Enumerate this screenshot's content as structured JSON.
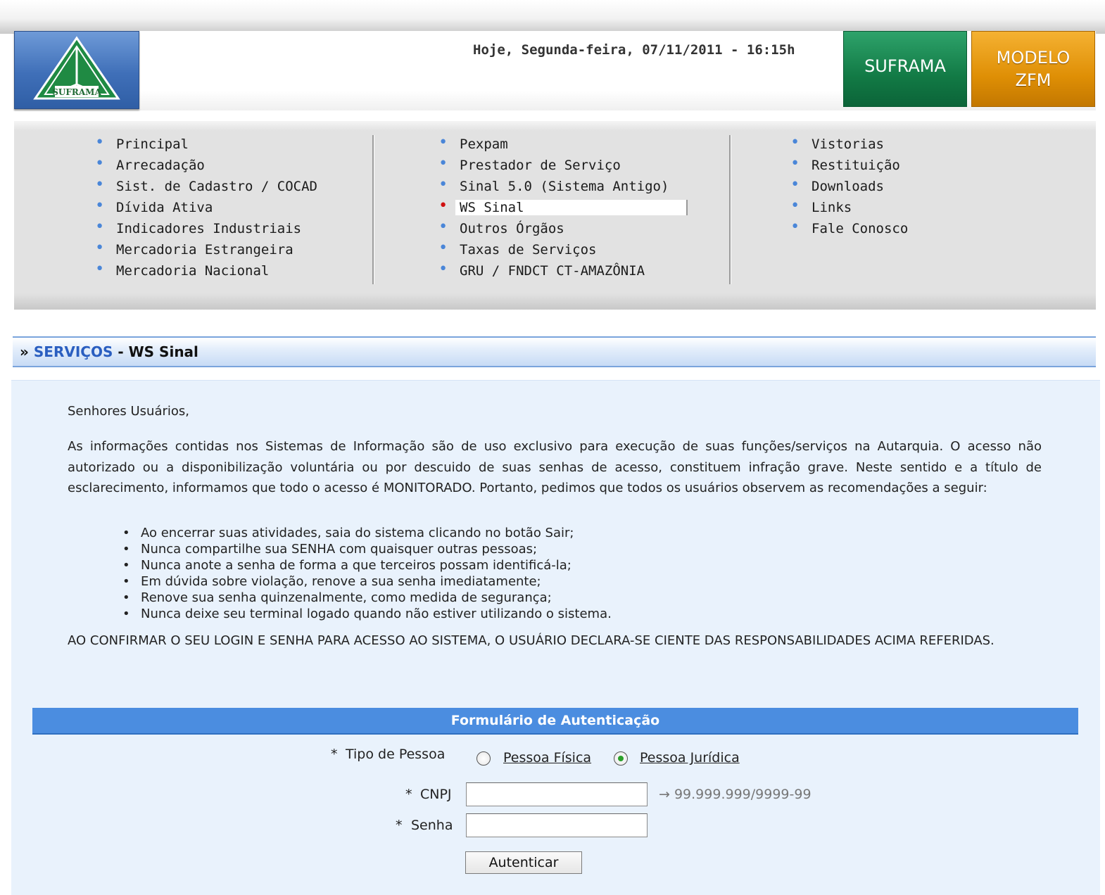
{
  "header": {
    "date_text": "Hoje, Segunda-feira, 07/11/2011 - 16:15h",
    "logo_text": "SUFRAMA",
    "button_suframa": "SUFRAMA",
    "button_modelo_line1": "MODELO",
    "button_modelo_line2": "ZFM"
  },
  "menu": {
    "col1": [
      "Principal",
      "Arrecadação",
      "Sist. de Cadastro / COCAD",
      "Dívida Ativa",
      "Indicadores Industriais",
      "Mercadoria Estrangeira",
      "Mercadoria Nacional"
    ],
    "col2": [
      "Pexpam",
      "Prestador de Serviço",
      "Sinal 5.0 (Sistema Antigo)",
      "WS Sinal",
      "Outros Órgãos",
      "Taxas de Serviços",
      "GRU / FNDCT CT-AMAZÔNIA"
    ],
    "col3": [
      "Vistorias",
      "Restituição",
      "Downloads",
      "Links",
      "Fale Conosco"
    ],
    "active_item": "WS Sinal"
  },
  "breadcrumb": {
    "prefix": "»",
    "section": "SERVIÇOS",
    "separator": "-",
    "current": "WS Sinal"
  },
  "notice": {
    "greeting": "Senhores Usuários,",
    "paragraph": "As informações contidas nos Sistemas de Informação são de uso exclusivo para execução de suas funções/serviços na Autarquia. O acesso não autorizado ou a disponibilização voluntária ou por descuido de suas senhas de acesso, constituem infração grave. Neste sentido e a título de esclarecimento, informamos que todo o acesso é MONITORADO. Portanto, pedimos que todos os usuários observem as recomendações a seguir:",
    "rules": [
      "Ao encerrar suas atividades, saia do sistema clicando no botão Sair;",
      "Nunca compartilhe sua SENHA com quaisquer outras pessoas;",
      "Nunca anote a senha de forma a que terceiros possam identificá-la;",
      "Em dúvida sobre violação, renove a sua senha imediatamente;",
      "Renove sua senha quinzenalmente, como medida de segurança;",
      "Nunca deixe seu terminal logado quando não estiver utilizando o sistema."
    ],
    "closing": "AO CONFIRMAR O SEU LOGIN E SENHA PARA ACESSO AO SISTEMA, O USUÁRIO DECLARA-SE CIENTE DAS RESPONSABILIDADES ACIMA REFERIDAS."
  },
  "form": {
    "title": "Formulário de Autenticação",
    "required_mark": "*",
    "tipo_label": "Tipo de Pessoa",
    "option_fisica": "Pessoa Física",
    "option_juridica": "Pessoa Jurídica",
    "selected_option": "Pessoa Jurídica",
    "cnpj_label": "CNPJ",
    "cnpj_value": "",
    "cnpj_hint": "99.999.999/9999-99",
    "senha_label": "Senha",
    "senha_value": "",
    "submit_label": "Autenticar"
  },
  "colors": {
    "menu_bullet": "#4a86d8",
    "active_bullet": "#d01010",
    "form_header": "#4b8de0",
    "suframa_button": "#127a45",
    "modelo_button": "#df8f05",
    "required": "#f07a20"
  }
}
